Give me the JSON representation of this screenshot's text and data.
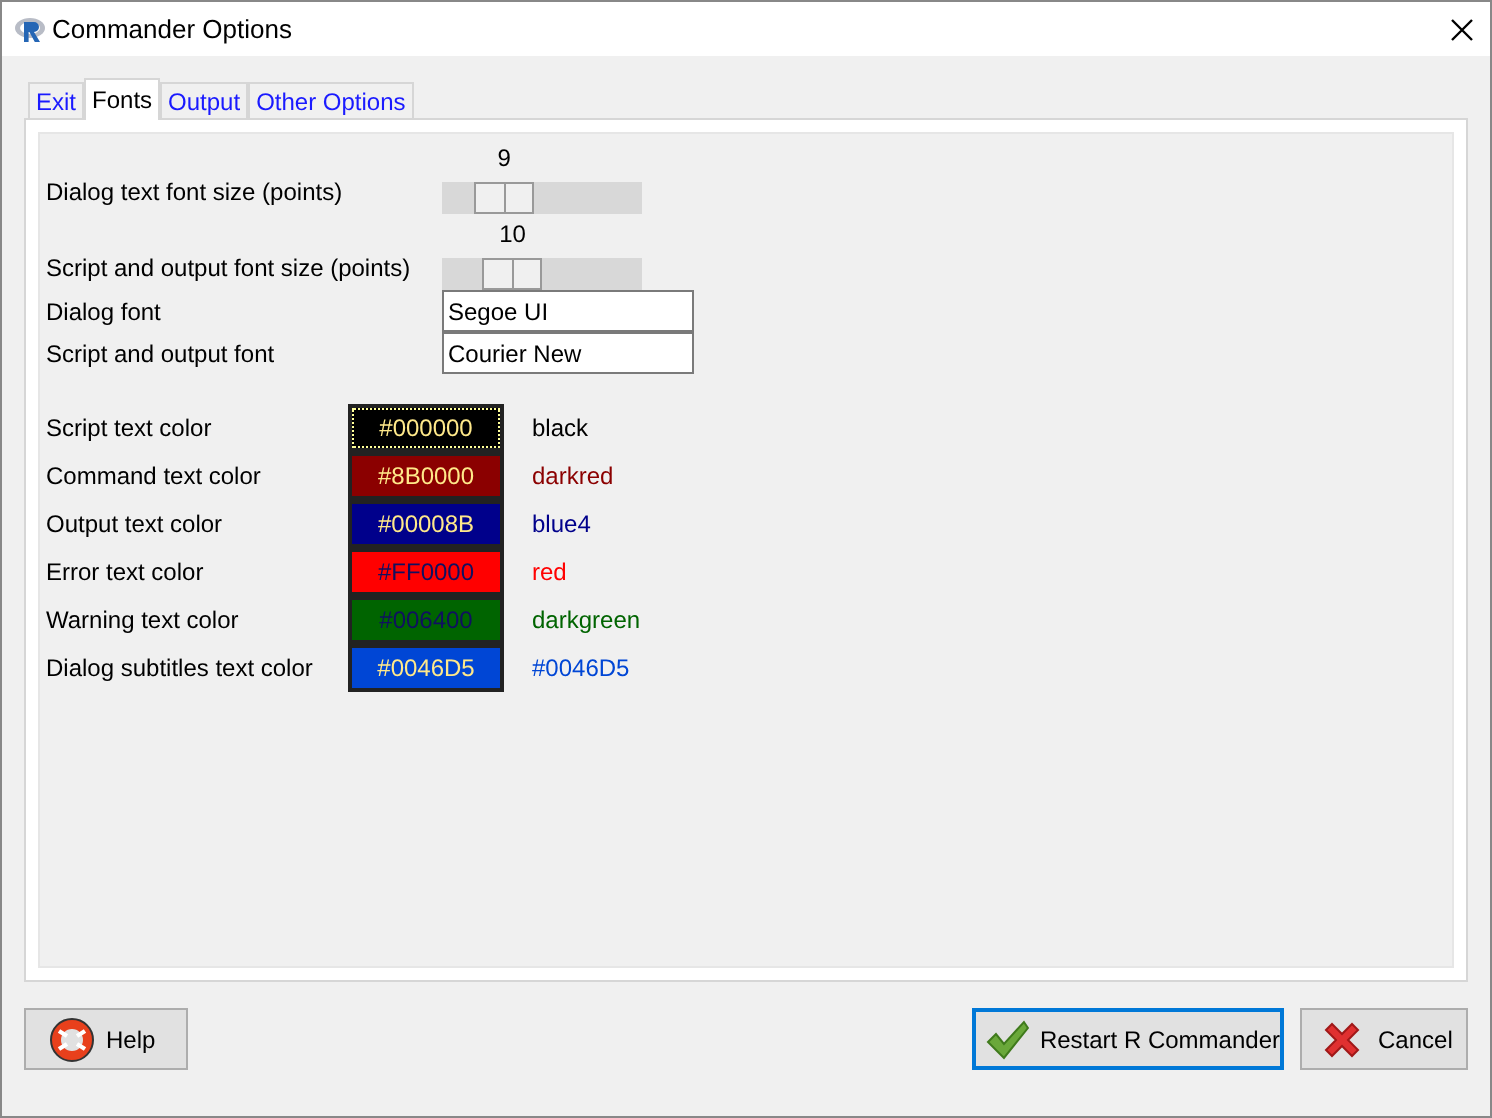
{
  "window": {
    "title": "Commander Options"
  },
  "tabs": [
    {
      "label": "Exit",
      "selected": false
    },
    {
      "label": "Fonts",
      "selected": true
    },
    {
      "label": "Output",
      "selected": false
    },
    {
      "label": "Other Options",
      "selected": false
    }
  ],
  "sliders": [
    {
      "label": "Dialog text font size (points)",
      "value": "9",
      "level": 0.23
    },
    {
      "label": "Script and output font size (points)",
      "value": "10",
      "level": 0.29
    }
  ],
  "font_fields": [
    {
      "label": "Dialog font",
      "value": "Segoe UI"
    },
    {
      "label": "Script and output font",
      "value": "Courier New"
    }
  ],
  "colors": [
    {
      "label": "Script text color",
      "hex": "#000000",
      "name": "black",
      "color": "#000000",
      "focused": true
    },
    {
      "label": "Command text color",
      "hex": "#8B0000",
      "name": "darkred",
      "color": "#8b0000",
      "focused": false
    },
    {
      "label": "Output text color",
      "hex": "#00008B",
      "name": "blue4",
      "color": "#00008b",
      "focused": false
    },
    {
      "label": "Error text color",
      "hex": "#FF0000",
      "name": "red",
      "color": "#ff0000",
      "focused": false
    },
    {
      "label": "Warning text color",
      "hex": "#006400",
      "name": "darkgreen",
      "color": "#006400",
      "focused": false
    },
    {
      "label": "Dialog subtitles text color",
      "hex": "#0046D5",
      "name": "#0046D5",
      "color": "#0046d5",
      "focused": false
    }
  ],
  "buttons": {
    "help": "Help",
    "restart": "Restart R Commander",
    "cancel": "Cancel"
  }
}
